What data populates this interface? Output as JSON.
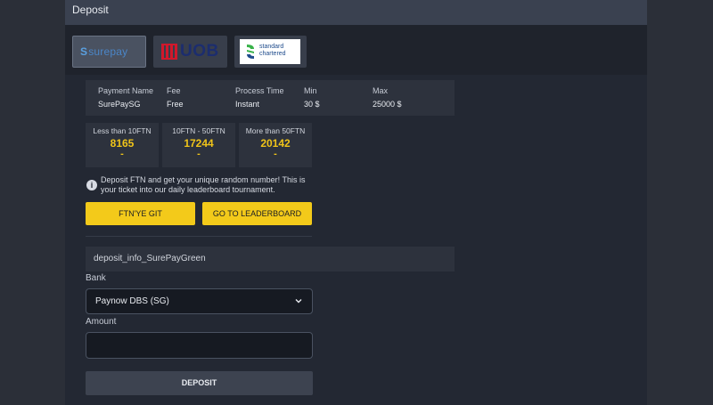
{
  "header": {
    "title": "Deposit"
  },
  "payment_methods": [
    {
      "name": "surepay",
      "logo_text": "surepay",
      "selected": true,
      "brand_color": "#4a86c8"
    },
    {
      "name": "UOB",
      "logo_text": "UOB",
      "selected": false,
      "brand_color": "#1c2d6e",
      "accent": "#d1182b"
    },
    {
      "name": "Standard Chartered",
      "logo_line1": "standard",
      "logo_line2": "chartered",
      "selected": false,
      "brand_color": "#1f4c8c",
      "accent": "#38b249"
    }
  ],
  "info": {
    "payment_name": {
      "label": "Payment Name",
      "value": "SurePaySG"
    },
    "fee": {
      "label": "Fee",
      "value": "Free"
    },
    "process_time": {
      "label": "Process Time",
      "value": "Instant"
    },
    "min": {
      "label": "Min",
      "value": "30 $"
    },
    "max": {
      "label": "Max",
      "value": "25000 $"
    }
  },
  "tiers": [
    {
      "label": "Less than 10FTN",
      "number": "8165",
      "dash": "-"
    },
    {
      "label": "10FTN - 50FTN",
      "number": "17244",
      "dash": "-"
    },
    {
      "label": "More than 50FTN",
      "number": "20142",
      "dash": "-"
    }
  ],
  "notice": {
    "icon": "info-icon",
    "text": "Deposit FTN and get your unique random number! This is your ticket into our daily leaderboard tournament."
  },
  "buttons": {
    "ftn": "FTN'YE GIT",
    "leaderboard": "GO TO LEADERBOARD",
    "deposit": "DEPOSIT"
  },
  "deposit_info": "deposit_info_SurePayGreen",
  "form": {
    "bank_label": "Bank",
    "bank_value": "Paynow DBS (SG)",
    "amount_label": "Amount",
    "amount_value": "",
    "amount_placeholder": ""
  },
  "colors": {
    "accent": "#f3ca1a",
    "panel": "#232833",
    "header": "#3a4150"
  }
}
